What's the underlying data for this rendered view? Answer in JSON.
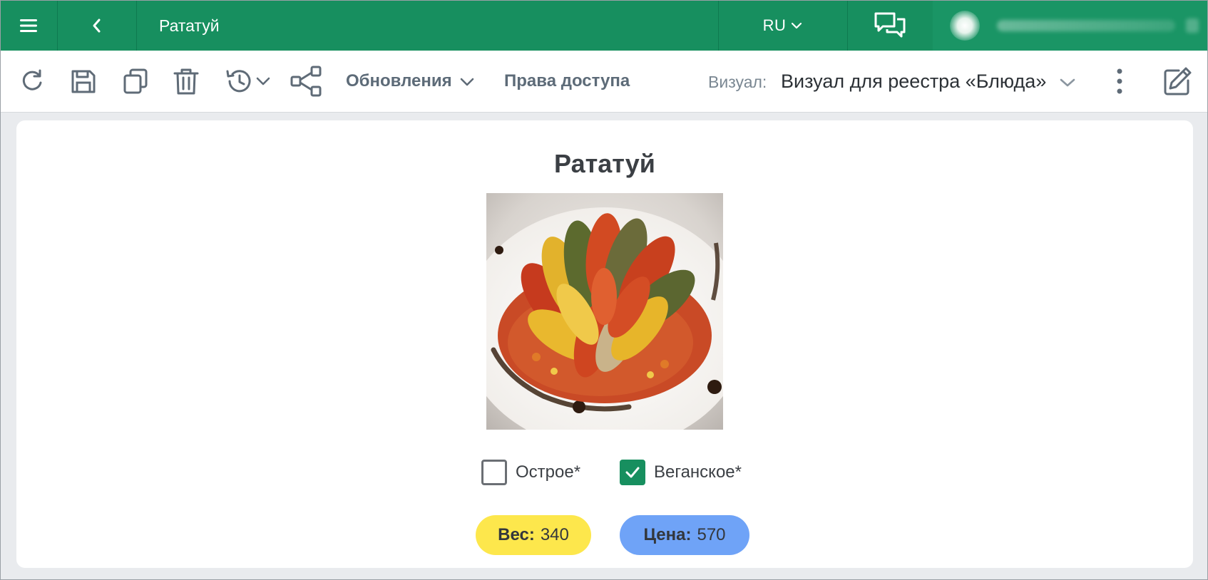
{
  "topbar": {
    "title": "Рататуй",
    "language": "RU",
    "icons": {
      "menu": "menu-icon",
      "back": "chevron-left-icon",
      "lang_dropdown": "chevron-down-icon",
      "chat": "chat-icon"
    },
    "bg_color": "#178f5f"
  },
  "toolbar": {
    "updates_label": "Обновления",
    "access_label": "Права доступа",
    "visual_label": "Визуал:",
    "visual_value": "Визуал для реестра «Блюда»",
    "icons": [
      "refresh-icon",
      "save-icon",
      "copy-icon",
      "delete-icon",
      "history-icon",
      "share-icon",
      "more-icon",
      "edit-icon"
    ]
  },
  "card": {
    "title": "Рататуй",
    "image_alt": "ratatouille-photo",
    "checkboxes": [
      {
        "label": "Острое*",
        "checked": false
      },
      {
        "label": "Веганское*",
        "checked": true
      }
    ],
    "weight": {
      "label": "Вес:",
      "value": "340",
      "color": "#fde74c"
    },
    "price": {
      "label": "Цена:",
      "value": "570",
      "color": "#6fa3f7"
    }
  }
}
